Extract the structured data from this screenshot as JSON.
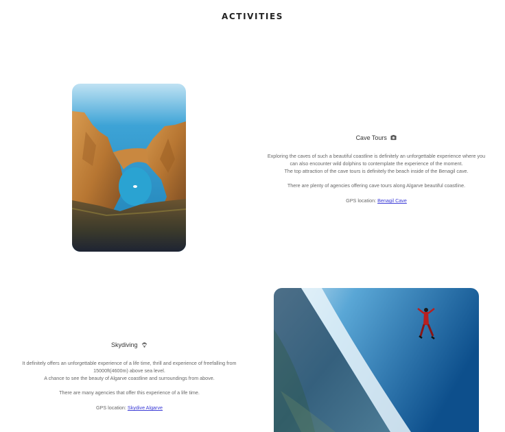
{
  "page": {
    "title": "ACTIVITIES"
  },
  "activities": [
    {
      "title": "Cave Tours",
      "icon": "camera-icon",
      "description_lines": [
        "Exploring the caves of such a beautiful coastline is definitely an unforgettable experience where you",
        "can also encounter wild dolphins to contemplate the experience of the moment.",
        "The top attraction of the cave tours is definitely the beach inside of the Benagil cave."
      ],
      "agencies_text": "There are plenty of agencies offering cave tours along Algarve beautiful coastline.",
      "gps_label": "GPS location:",
      "gps_link": "Benagil Cave"
    },
    {
      "title": "Skydiving",
      "icon": "parachute-icon",
      "description_lines": [
        "It definitely offers an unforgettable experience of a life time, thrill and experience of freefalling from",
        "15000ft(4600m) above sea level.",
        "A chance to see the beauty of Algarve coastline and surroundings from above."
      ],
      "agencies_text": "There are many agencies that offer this experience of a life time.",
      "gps_label": "GPS location:",
      "gps_link": "Skydive Algarve"
    }
  ]
}
